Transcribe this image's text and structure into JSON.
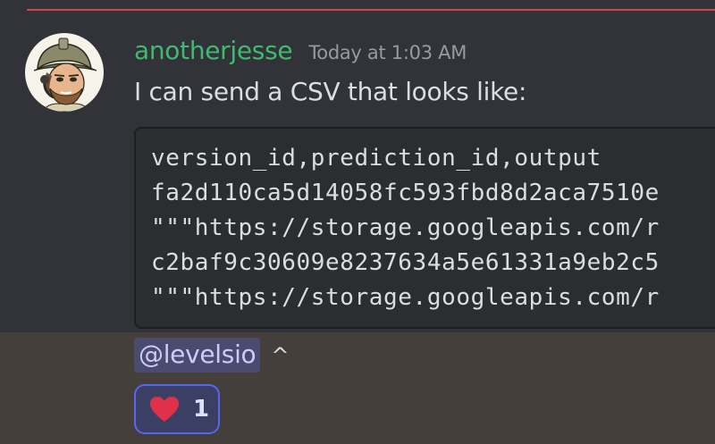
{
  "message": {
    "username": "anotherjesse",
    "timestamp": "Today at 1:03 AM",
    "text": "I can send a CSV that looks like:",
    "code_lines": [
      "version_id,prediction_id,output",
      "fa2d110ca5d14058fc593fbd8d2aca7510e",
      "\"\"\"https://storage.googleapis.com/r",
      "c2baf9c30609e8237634a5e61331a9eb2c5",
      "\"\"\"https://storage.googleapis.com/r"
    ]
  },
  "reply": {
    "mention": "@levelsio",
    "text": "^"
  },
  "reaction": {
    "emoji": "heart-icon",
    "count": "1"
  },
  "colors": {
    "username": "#3fba6f",
    "divider": "#e5484d",
    "mention_bg": "#4a4b6e",
    "reaction_border": "#5865f2",
    "heart": "#e0304a"
  }
}
